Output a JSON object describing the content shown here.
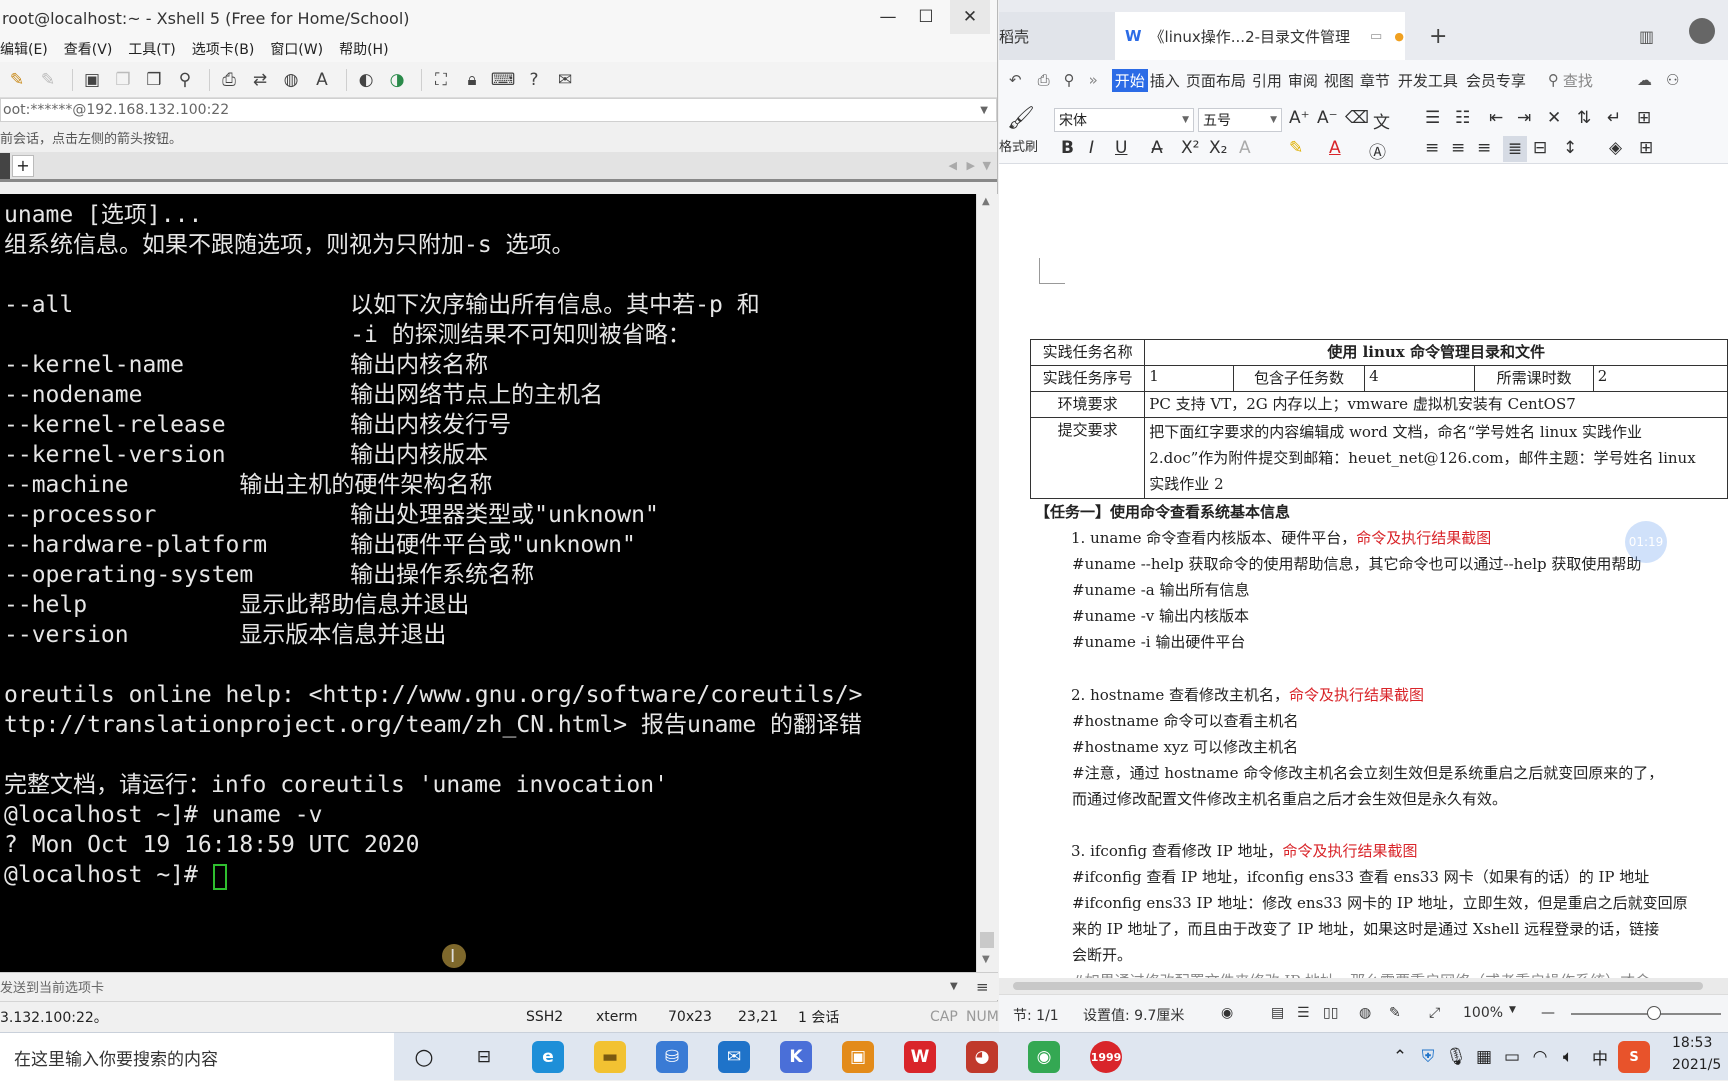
{
  "xshell": {
    "title": "root@localhost:~ - Xshell 5 (Free for Home/School)",
    "menu": [
      "编辑(E)",
      "查看(V)",
      "工具(T)",
      "选项卡(B)",
      "窗口(W)",
      "帮助(H)"
    ],
    "address": "oot:******@192.168.132.100:22",
    "hint": "前会话，点击左侧的箭头按钮。",
    "add_tab": "+",
    "terminal_lines": [
      "uname [选项]...",
      "组系统信息。如果不跟随选项，则视为只附加-s 选项。",
      "",
      "--all                    以如下次序输出所有信息。其中若-p 和",
      "                         -i 的探测结果不可知则被省略：",
      "--kernel-name            输出内核名称",
      "--nodename               输出网络节点上的主机名",
      "--kernel-release         输出内核发行号",
      "--kernel-version         输出内核版本",
      "--machine        输出主机的硬件架构名称",
      "--processor              输出处理器类型或\"unknown\"",
      "--hardware-platform      输出硬件平台或\"unknown\"",
      "--operating-system       输出操作系统名称",
      "--help           显示此帮助信息并退出",
      "--version        显示版本信息并退出",
      "",
      "oreutils online help: <http://www.gnu.org/software/coreutils/>",
      "ttp://translationproject.org/team/zh_CN.html> 报告uname 的翻译错",
      "",
      "完整文档，请运行：info coreutils 'uname invocation'",
      "@localhost ~]# uname -v",
      "? Mon Oct 19 16:18:59 UTC 2020",
      "@localhost ~]# "
    ],
    "send_hint": "发送到当前选项卡",
    "status": {
      "host": "3.132.100:22。",
      "protocol": "SSH2",
      "term": "xterm",
      "size": "70x23",
      "cursor": "23,21",
      "sessions": "1 会话",
      "cap": "CAP",
      "num": "NUM"
    }
  },
  "wps": {
    "tab_left": "稻壳",
    "tab_doc": "《linux操作...2-目录文件管理",
    "new_tab": "+",
    "menu": [
      "开始",
      "插入",
      "页面布局",
      "引用",
      "审阅",
      "视图",
      "章节",
      "开发工具",
      "会员专享"
    ],
    "search": "查找",
    "format_painter": "格式刷",
    "font": "宋体",
    "font_size": "五号",
    "table": {
      "r1c1": "实践任务名称",
      "r1c2": "使用 linux 命令管理目录和文件",
      "r2": [
        "实践任务序号",
        "1",
        "包含子任务数",
        "4",
        "所需课时数",
        "2"
      ],
      "r3c1": "环境要求",
      "r3c2": "PC 支持 VT，2G 内存以上；vmware 虚拟机安装有 CentOS7",
      "r4c1": "提交要求",
      "r4c2a": "把下面红字要求的内容编辑成 word 文档，命名“学号姓名 linux 实践作业",
      "r4c2b": "2.doc”作为附件提交到邮箱：heuet_net@126.com，邮件主题：学号姓名 linux",
      "r4c2c": "实践作业 2"
    },
    "task1": "【任务一】使用命令查看系统基本信息",
    "s1_title": "1.  uname 命令查看内核版本、硬件平台，",
    "s1_red": "命令及执行结果截图",
    "s1_l1": "#uname   --help 获取命令的使用帮助信息，其它命令也可以通过--help 获取使用帮助",
    "s1_l2": "#uname   -a 输出所有信息",
    "s1_l3": "#uname   -v 输出内核版本",
    "s1_l4": "#uname   -i 输出硬件平台",
    "s2_title": "2.  hostname 查看修改主机名，",
    "s2_red": "命令及执行结果截图",
    "s2_l1": "#hostname 命令可以查看主机名",
    "s2_l2": "#hostname   xyz 可以修改主机名",
    "s2_l3": "#注意，通过 hostname 命令修改主机名会立刻生效但是系统重启之后就变回原来的了，",
    "s2_l4": "而通过修改配置文件修改主机名重启之后才会生效但是永久有效。",
    "s3_title": "3.  ifconfig 查看修改 IP 地址，",
    "s3_red": "命令及执行结果截图",
    "s3_l1": "#ifconfig 查看 IP 地址，ifconfig ens33 查看 ens33 网卡（如果有的话）的 IP 地址",
    "s3_l2": "#ifconfig ens33 IP 地址：修改 ens33 网卡的 IP 地址，立即生效，但是重启之后就变回原",
    "s3_l3": "来的 IP 地址了，而且由于改变了 IP 地址，如果这时是通过 Xshell 远程登录的话，链接",
    "s3_l4": "会断开。",
    "s3_l5": "#如果通过修改配置文件来修改 IP 地址，那么需要重启网络（或者重启操作系统）才会",
    "timer": "01:19",
    "status": {
      "page": "节: 1/1",
      "setting": "设置值: 9.7厘米",
      "zoom": "100%"
    }
  },
  "taskbar": {
    "search": "在这里输入你要搜索的内容",
    "time": "18:53",
    "date": "2021/5",
    "ime": "中"
  }
}
